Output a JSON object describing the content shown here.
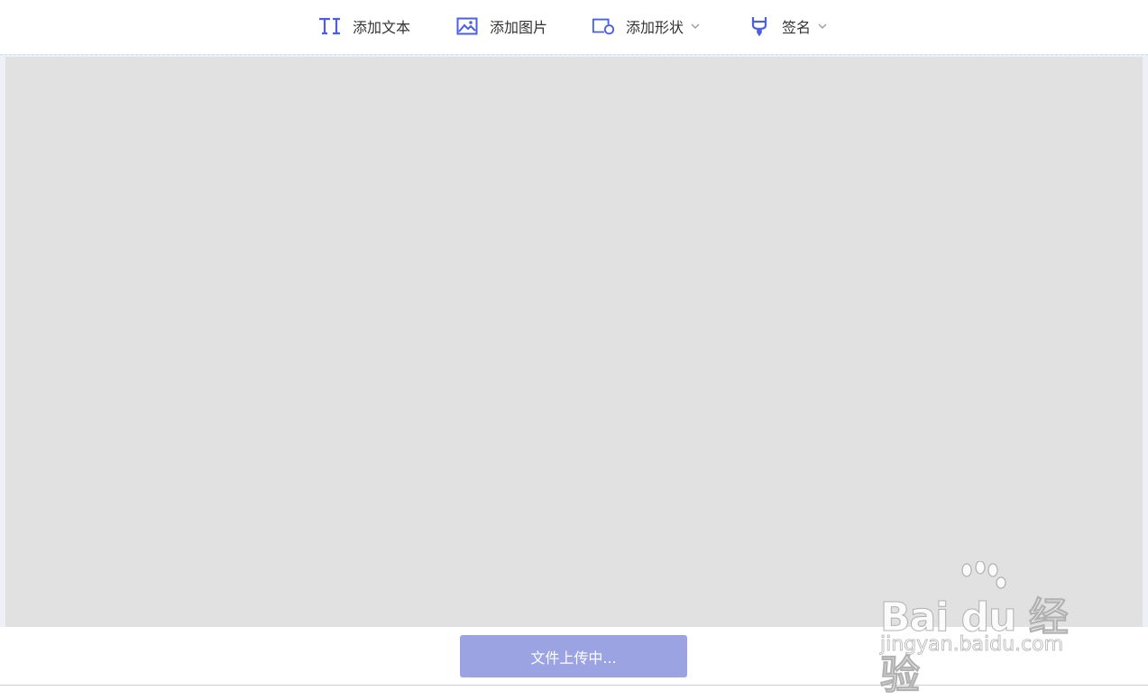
{
  "toolbar": {
    "add_text_label": "添加文本",
    "add_image_label": "添加图片",
    "add_shape_label": "添加形状",
    "signature_label": "签名",
    "accent_color": "#4a5ee8"
  },
  "canvas": {
    "document_color": "#e1e1e1"
  },
  "bottom_bar": {
    "status_button_label": "文件上传中...",
    "button_color": "#9ba3e2"
  },
  "watermark": {
    "logo_text": "Bai du 经验",
    "domain_text": "jingyan.baidu.com"
  }
}
